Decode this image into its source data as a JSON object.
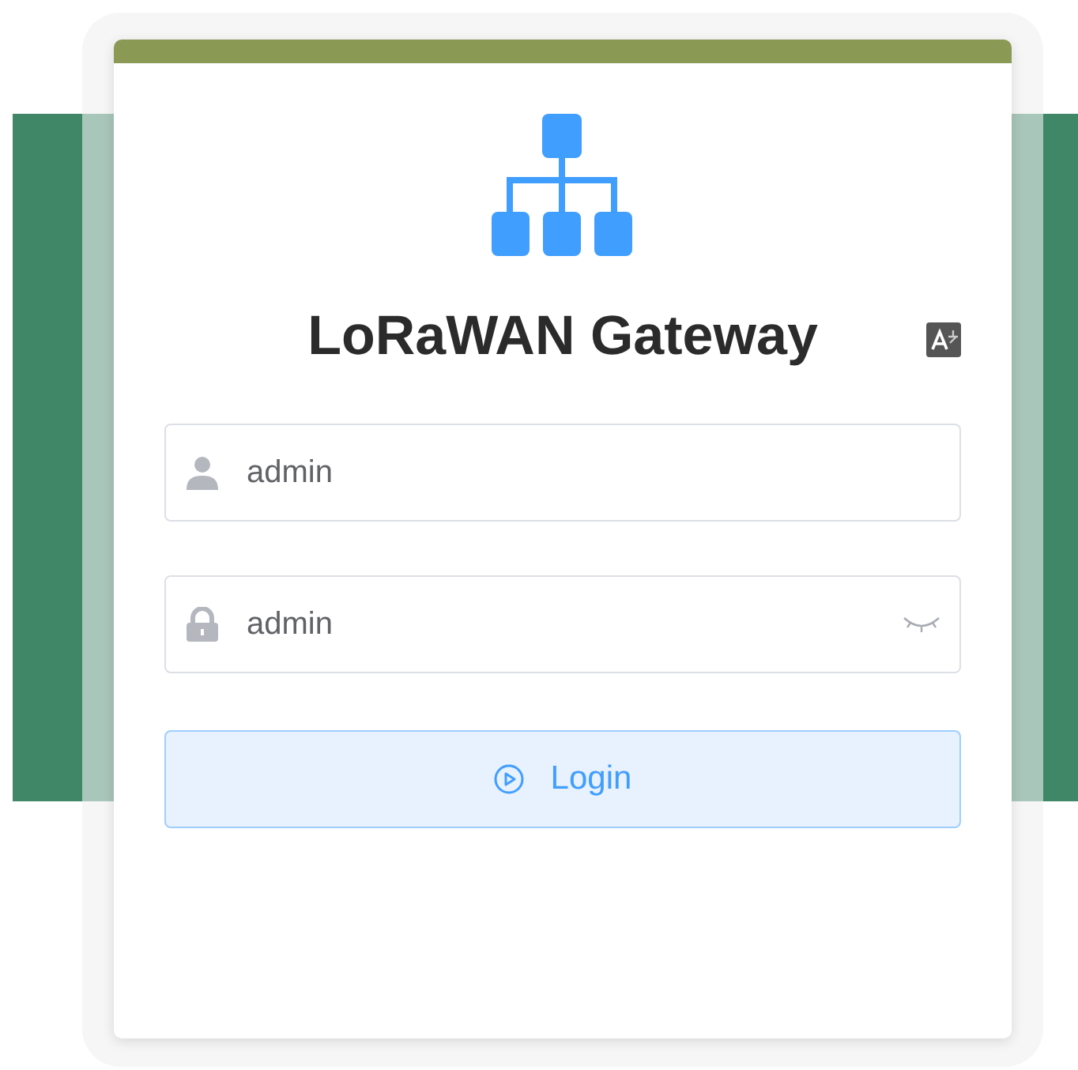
{
  "title": "LoRaWAN Gateway",
  "fields": [
    {
      "kind": "user",
      "value": "admin"
    },
    {
      "kind": "password",
      "value": "admin"
    }
  ],
  "login_button": {
    "label": "Login"
  }
}
